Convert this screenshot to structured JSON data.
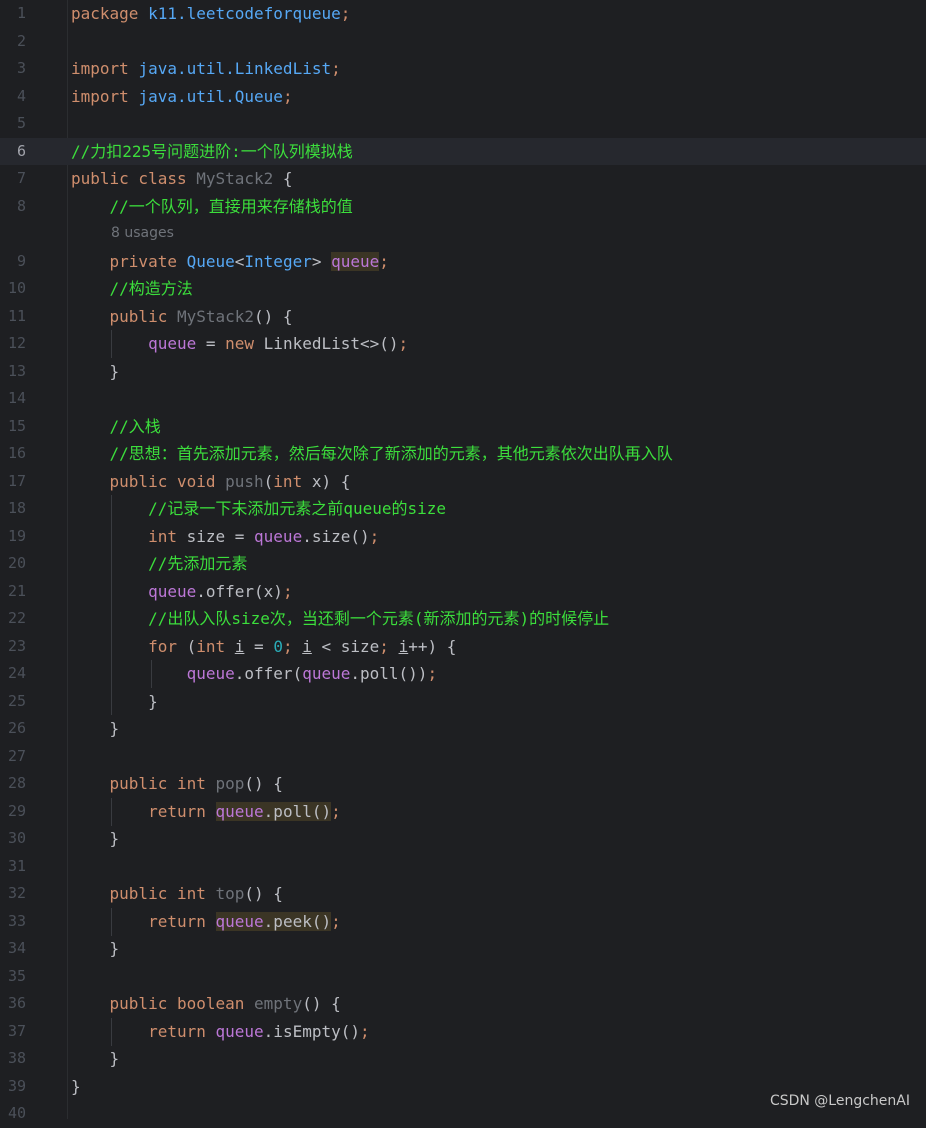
{
  "editor": {
    "current_line": 6,
    "lines": [
      {
        "n": "1",
        "parts": [
          [
            "k",
            "package "
          ],
          [
            "pkg",
            "k11.leetcodeforqueue"
          ],
          [
            "k",
            ";"
          ]
        ]
      },
      {
        "n": "2",
        "parts": []
      },
      {
        "n": "3",
        "parts": [
          [
            "k",
            "import "
          ],
          [
            "pkg",
            "java.util."
          ],
          [
            "t",
            "LinkedList"
          ],
          [
            "k",
            ";"
          ]
        ]
      },
      {
        "n": "4",
        "parts": [
          [
            "k",
            "import "
          ],
          [
            "pkg",
            "java.util."
          ],
          [
            "t",
            "Queue"
          ],
          [
            "k",
            ";"
          ]
        ]
      },
      {
        "n": "5",
        "parts": []
      },
      {
        "n": "6",
        "parts": [
          [
            "c",
            "//力扣225号问题进阶:一个队列模拟栈"
          ]
        ]
      },
      {
        "n": "7",
        "parts": [
          [
            "k",
            "public class "
          ],
          [
            "fn",
            "MyStack2"
          ],
          [
            "p",
            " {"
          ]
        ]
      },
      {
        "n": "8",
        "parts": [
          [
            "p",
            "    "
          ],
          [
            "c",
            "//一个队列，直接用来存储栈的值"
          ]
        ]
      },
      {
        "n": "",
        "inlay": "8 usages"
      },
      {
        "n": "9",
        "parts": [
          [
            "p",
            "    "
          ],
          [
            "k",
            "private "
          ],
          [
            "t",
            "Queue"
          ],
          [
            "p",
            "<"
          ],
          [
            "t",
            "Integer"
          ],
          [
            "p",
            "> "
          ],
          [
            "f hl",
            "queue"
          ],
          [
            "k",
            ";"
          ]
        ]
      },
      {
        "n": "10",
        "parts": [
          [
            "p",
            "    "
          ],
          [
            "c",
            "//构造方法"
          ]
        ]
      },
      {
        "n": "11",
        "parts": [
          [
            "p",
            "    "
          ],
          [
            "k",
            "public "
          ],
          [
            "fn",
            "MyStack2"
          ],
          [
            "p",
            "() {"
          ]
        ]
      },
      {
        "n": "12",
        "parts": [
          [
            "p",
            "        "
          ],
          [
            "f",
            "queue"
          ],
          [
            "p",
            " = "
          ],
          [
            "k",
            "new "
          ],
          [
            "p",
            "LinkedList<>()"
          ],
          [
            "k",
            ";"
          ]
        ]
      },
      {
        "n": "13",
        "parts": [
          [
            "p",
            "    }"
          ]
        ]
      },
      {
        "n": "14",
        "parts": []
      },
      {
        "n": "15",
        "parts": [
          [
            "p",
            "    "
          ],
          [
            "c",
            "//入栈"
          ]
        ]
      },
      {
        "n": "16",
        "parts": [
          [
            "p",
            "    "
          ],
          [
            "c",
            "//思想：首先添加元素，然后每次除了新添加的元素，其他元素依次出队再入队"
          ]
        ]
      },
      {
        "n": "17",
        "parts": [
          [
            "p",
            "    "
          ],
          [
            "k",
            "public void "
          ],
          [
            "fn",
            "push"
          ],
          [
            "p",
            "("
          ],
          [
            "k",
            "int "
          ],
          [
            "p",
            "x) {"
          ]
        ]
      },
      {
        "n": "18",
        "parts": [
          [
            "p",
            "        "
          ],
          [
            "c",
            "//记录一下未添加元素之前queue的size"
          ]
        ]
      },
      {
        "n": "19",
        "parts": [
          [
            "p",
            "        "
          ],
          [
            "k",
            "int "
          ],
          [
            "p",
            "size = "
          ],
          [
            "f",
            "queue"
          ],
          [
            "p",
            ".size()"
          ],
          [
            "k",
            ";"
          ]
        ]
      },
      {
        "n": "20",
        "parts": [
          [
            "p",
            "        "
          ],
          [
            "c",
            "//先添加元素"
          ]
        ]
      },
      {
        "n": "21",
        "parts": [
          [
            "p",
            "        "
          ],
          [
            "f",
            "queue"
          ],
          [
            "p",
            ".offer(x)"
          ],
          [
            "k",
            ";"
          ]
        ]
      },
      {
        "n": "22",
        "parts": [
          [
            "p",
            "        "
          ],
          [
            "c",
            "//出队入队size次，当还剩一个元素(新添加的元素)的时候停止"
          ]
        ]
      },
      {
        "n": "23",
        "parts": [
          [
            "p",
            "        "
          ],
          [
            "k",
            "for "
          ],
          [
            "p",
            "("
          ],
          [
            "k",
            "int "
          ],
          [
            "p ul",
            "i"
          ],
          [
            "p",
            " = "
          ],
          [
            "num",
            "0"
          ],
          [
            "k",
            "; "
          ],
          [
            "p ul",
            "i"
          ],
          [
            "p",
            " < size"
          ],
          [
            "k",
            "; "
          ],
          [
            "p ul",
            "i"
          ],
          [
            "p",
            "++) {"
          ]
        ]
      },
      {
        "n": "24",
        "parts": [
          [
            "p",
            "            "
          ],
          [
            "f",
            "queue"
          ],
          [
            "p",
            ".offer("
          ],
          [
            "f",
            "queue"
          ],
          [
            "p",
            ".poll())"
          ],
          [
            "k",
            ";"
          ]
        ]
      },
      {
        "n": "25",
        "parts": [
          [
            "p",
            "        }"
          ]
        ]
      },
      {
        "n": "26",
        "parts": [
          [
            "p",
            "    }"
          ]
        ]
      },
      {
        "n": "27",
        "parts": []
      },
      {
        "n": "28",
        "parts": [
          [
            "p",
            "    "
          ],
          [
            "k",
            "public int "
          ],
          [
            "fn",
            "pop"
          ],
          [
            "p",
            "() {"
          ]
        ]
      },
      {
        "n": "29",
        "parts": [
          [
            "p",
            "        "
          ],
          [
            "k",
            "return "
          ],
          [
            "f hl",
            "queue"
          ],
          [
            "p hl",
            ".poll()"
          ],
          [
            "k",
            ";"
          ]
        ]
      },
      {
        "n": "30",
        "parts": [
          [
            "p",
            "    }"
          ]
        ]
      },
      {
        "n": "31",
        "parts": []
      },
      {
        "n": "32",
        "parts": [
          [
            "p",
            "    "
          ],
          [
            "k",
            "public int "
          ],
          [
            "fn",
            "top"
          ],
          [
            "p",
            "() {"
          ]
        ]
      },
      {
        "n": "33",
        "parts": [
          [
            "p",
            "        "
          ],
          [
            "k",
            "return "
          ],
          [
            "f hl",
            "queue"
          ],
          [
            "p hl",
            ".peek()"
          ],
          [
            "k",
            ";"
          ]
        ]
      },
      {
        "n": "34",
        "parts": [
          [
            "p",
            "    }"
          ]
        ]
      },
      {
        "n": "35",
        "parts": []
      },
      {
        "n": "36",
        "parts": [
          [
            "p",
            "    "
          ],
          [
            "k",
            "public boolean "
          ],
          [
            "fn",
            "empty"
          ],
          [
            "p",
            "() {"
          ]
        ]
      },
      {
        "n": "37",
        "parts": [
          [
            "p",
            "        "
          ],
          [
            "k",
            "return "
          ],
          [
            "f",
            "queue"
          ],
          [
            "p",
            ".isEmpty()"
          ],
          [
            "k",
            ";"
          ]
        ]
      },
      {
        "n": "38",
        "parts": [
          [
            "p",
            "    }"
          ]
        ]
      },
      {
        "n": "39",
        "parts": [
          [
            "p",
            "}"
          ]
        ]
      },
      {
        "n": "40",
        "parts": []
      }
    ]
  },
  "watermark": "CSDN @LengchenAI",
  "colors": {
    "background": "#1e1f22",
    "keyword": "#cf8e6d",
    "type": "#56a8f5",
    "comment": "#3cde3c",
    "field": "#bc77d7",
    "number": "#2aacb8",
    "plain": "#bcbec4"
  }
}
